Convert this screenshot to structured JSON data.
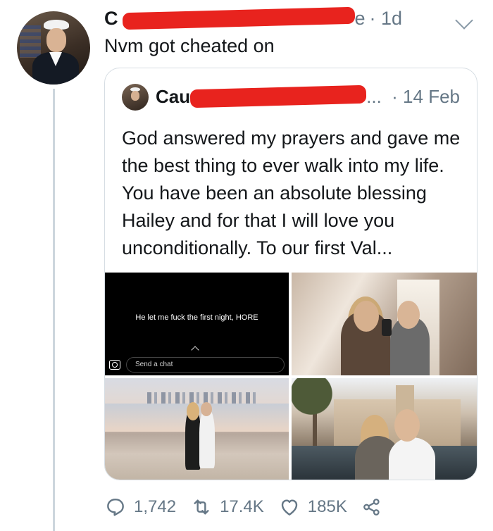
{
  "tweet": {
    "name_visible": "C",
    "handle_tail": "e",
    "time": "· 1d",
    "text": "Nvm got cheated on"
  },
  "quoted": {
    "name_visible": "Cau",
    "handle_tail": "...",
    "time": "· 14 Feb",
    "text": "God answered my prayers and gave me the best thing to ever walk into my life. You have been an absolute blessing Hailey and for that I will love you unconditionally. To our first Val...",
    "snap": {
      "caption": "He let me fuck the first night, HORE",
      "chat_placeholder": "Send a chat"
    }
  },
  "actions": {
    "replies": "1,742",
    "retweets": "17.4K",
    "likes": "185K"
  },
  "icons": [
    "chevron-down-icon",
    "reply-icon",
    "retweet-icon",
    "like-icon",
    "share-icon",
    "camera-icon"
  ],
  "colors": {
    "redaction": "#e8231e",
    "muted": "#657786",
    "border": "#d6dde3"
  }
}
